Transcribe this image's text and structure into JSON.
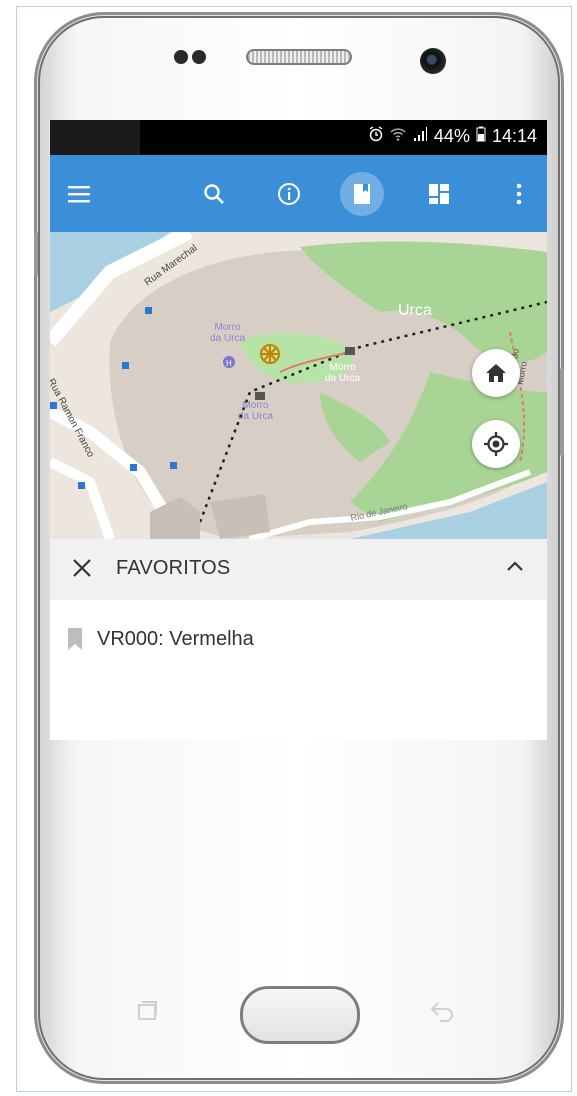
{
  "status_bar": {
    "battery": "44%",
    "time": "14:14"
  },
  "app_bar": {
    "icons": [
      "menu-icon",
      "search-icon",
      "info-icon",
      "bookmark-icon",
      "layers-icon",
      "more-vert-icon"
    ]
  },
  "map": {
    "labels": {
      "street_1": "Rua Marechal",
      "street_2": "Rua Ramon Franco",
      "urca": "Urca",
      "morro_1_line1": "Morro",
      "morro_1_line2": "da Urca",
      "morro_2_line1": "Morro",
      "morro_2_line2": "da Urca",
      "morro_3_line1": "Morro",
      "morro_3_line2": "da Urca",
      "trail": "Trilha do Morro",
      "rio": "Rio de Janeiro"
    },
    "colors": {
      "land": "#d8d2ca",
      "park": "#9fd08b",
      "water": "#a9d0e2",
      "road": "#ffffff"
    }
  },
  "favorites_panel": {
    "title": "FAVORITOS",
    "items": [
      {
        "label": "VR000: Vermelha",
        "icon": "bookmark-icon"
      }
    ]
  },
  "colors": {
    "app_bar": "#3b8fd8",
    "panel_header": "#f1f1f1"
  }
}
